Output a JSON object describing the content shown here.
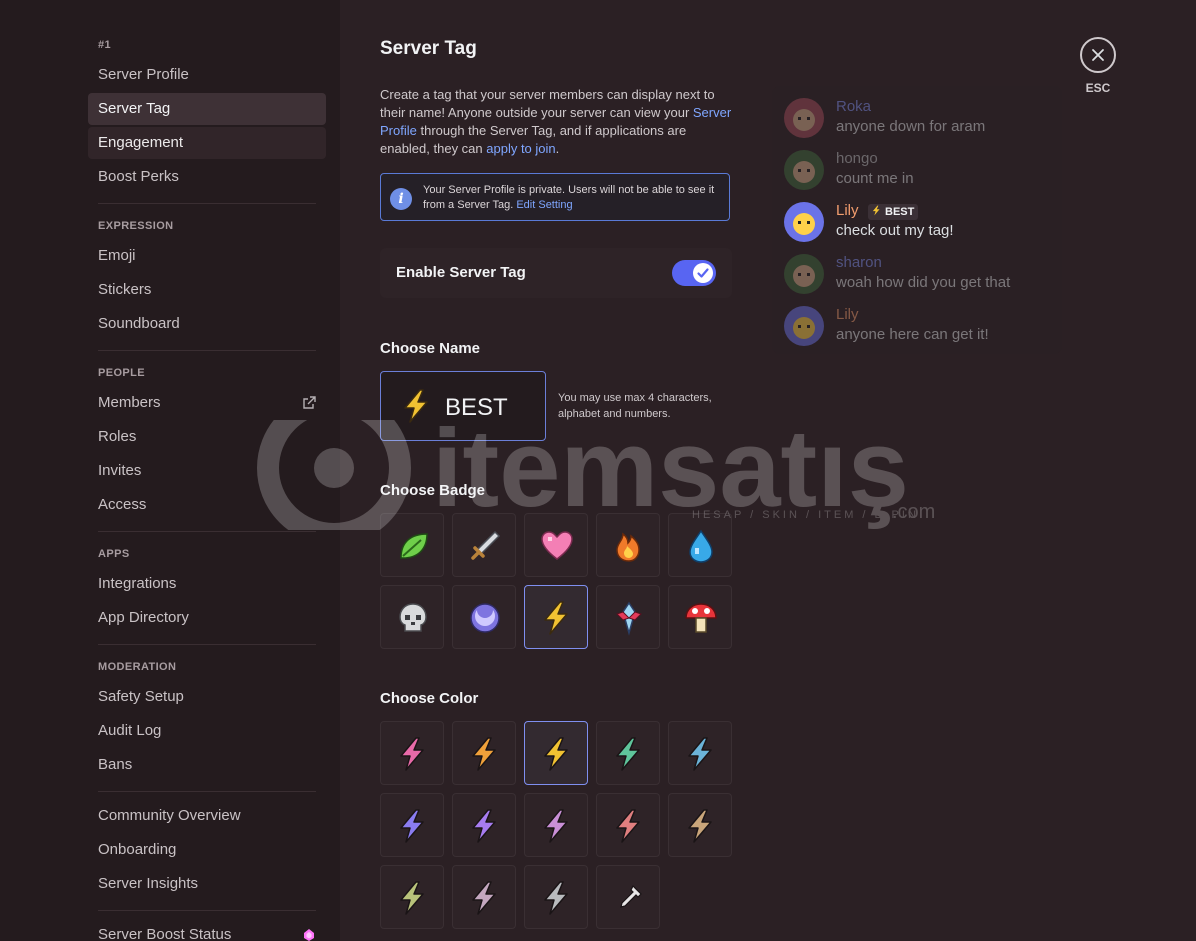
{
  "sidebar": {
    "server_header": "#1",
    "server_items": [
      "Server Profile",
      "Server Tag",
      "Engagement",
      "Boost Perks"
    ],
    "expression_header": "EXPRESSION",
    "expression_items": [
      "Emoji",
      "Stickers",
      "Soundboard"
    ],
    "people_header": "PEOPLE",
    "people_items": [
      "Members",
      "Roles",
      "Invites",
      "Access"
    ],
    "apps_header": "APPS",
    "apps_items": [
      "Integrations",
      "App Directory"
    ],
    "moderation_header": "MODERATION",
    "moderation_items": [
      "Safety Setup",
      "Audit Log",
      "Bans"
    ],
    "community_items": [
      "Community Overview",
      "Onboarding",
      "Server Insights"
    ],
    "boost_item": "Server Boost Status",
    "active_item": "Server Tag",
    "hovered_item": "Engagement"
  },
  "main": {
    "title": "Server Tag",
    "desc_part1": "Create a tag that your server members can display next to their name! Anyone outside your server can view your ",
    "desc_link1": "Server Profile",
    "desc_part2": " through the Server Tag, and if applications are enabled, they can ",
    "desc_link2": "apply to join",
    "desc_part3": ".",
    "notice_text": "Your Server Profile is private. Users will not be able to see it from a Server Tag. ",
    "notice_link": "Edit Setting",
    "toggle_label": "Enable Server Tag",
    "toggle_on": true,
    "choose_name_heading": "Choose Name",
    "tag_name": "BEST",
    "name_hint": "You may use max 4 characters, alphabet and numbers.",
    "choose_badge_heading": "Choose Badge",
    "badges": [
      "leaf-icon",
      "sword-icon",
      "heart-icon",
      "fire-icon",
      "water-drop-icon",
      "skull-icon",
      "moon-icon",
      "lightning-icon",
      "crystal-icon",
      "mushroom-icon"
    ],
    "selected_badge": 7,
    "choose_color_heading": "Choose Color",
    "colors": [
      "#e86aa8",
      "#f0a13a",
      "#f1c232",
      "#5fc59b",
      "#6bb3d8",
      "#8a7cf0",
      "#a77cf0",
      "#c98fd6",
      "#e07f7f",
      "#c9a57a",
      "#b8c27a",
      "#c4a7bf",
      "#b9bbbe"
    ],
    "selected_color": 2,
    "eyedropper_icon": "eyedropper-icon"
  },
  "preview": {
    "messages": [
      {
        "name": "Roka",
        "text": "anyone down for aram",
        "name_color": "#7e8ff0",
        "faded": true
      },
      {
        "name": "hongo",
        "text": "count me in",
        "name_color": "#b9bbbe",
        "faded": true
      },
      {
        "name": "Lily",
        "text": "check out my tag!",
        "name_color": "#f29d6e",
        "faded": false,
        "tag": "BEST"
      },
      {
        "name": "sharon",
        "text": "woah how did you get that",
        "name_color": "#7e8ff0",
        "faded": true
      },
      {
        "name": "Lily",
        "text": "anyone here can get it!",
        "name_color": "#f29d6e",
        "faded": true
      }
    ]
  },
  "close": {
    "label": "ESC"
  },
  "watermark": {
    "text": "itemsatış",
    "tagline": "HESAP / SKIN / ITEM / E-PIN",
    "suffix": ".com"
  }
}
